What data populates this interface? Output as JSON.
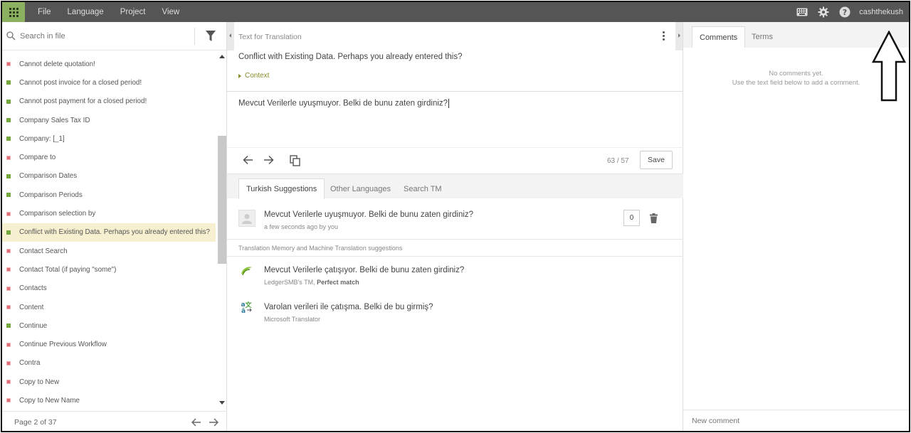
{
  "topbar": {
    "menu": [
      "File",
      "Language",
      "Project",
      "View"
    ],
    "username": "cashthekush",
    "accent": "#8bb05f"
  },
  "left": {
    "search_placeholder": "Search in file",
    "items": [
      {
        "label": "Cannot delete quotation!",
        "status": "red"
      },
      {
        "label": "Cannot post invoice for a closed period!",
        "status": "green"
      },
      {
        "label": "Cannot post payment for a closed period!",
        "status": "green"
      },
      {
        "label": "Company Sales Tax ID",
        "status": "green"
      },
      {
        "label": "Company: [_1]",
        "status": "green"
      },
      {
        "label": "Compare to",
        "status": "red"
      },
      {
        "label": "Comparison Dates",
        "status": "green"
      },
      {
        "label": "Comparison Periods",
        "status": "green"
      },
      {
        "label": "Comparison selection by",
        "status": "red"
      },
      {
        "label": "Conflict with Existing Data. Perhaps you already entered this?",
        "status": "green",
        "selected": true
      },
      {
        "label": "Contact Search",
        "status": "red"
      },
      {
        "label": "Contact Total (if paying \"some\")",
        "status": "red"
      },
      {
        "label": "Contacts",
        "status": "red"
      },
      {
        "label": "Content",
        "status": "red"
      },
      {
        "label": "Continue",
        "status": "green"
      },
      {
        "label": "Continue Previous Workflow",
        "status": "red"
      },
      {
        "label": "Contra",
        "status": "red"
      },
      {
        "label": "Copy to New",
        "status": "red"
      },
      {
        "label": "Copy to New Name",
        "status": "red"
      }
    ],
    "pager": "Page 2 of 37"
  },
  "middle": {
    "header": "Text for Translation",
    "source": "Conflict with Existing Data.  Perhaps you already entered this?",
    "context_label": "Context",
    "target": "Mevcut Verilerle uyuşmuyor. Belki de bunu zaten girdiniz?",
    "char_count": "63 / 57",
    "save_label": "Save",
    "tabs": [
      "Turkish Suggestions",
      "Other Languages",
      "Search TM"
    ],
    "own_suggestion": {
      "text": "Mevcut Verilerle uyuşmuyor. Belki de bunu zaten girdiniz?",
      "meta": "a few seconds ago by you",
      "count": "0"
    },
    "tm_header": "Translation Memory and Machine Translation suggestions",
    "tm_suggestions": [
      {
        "text": "Mevcut Verilerle çatışıyor. Belki de bunu zaten girdiniz?",
        "source": "LedgerSMB's TM,",
        "match": "Perfect match",
        "icon": "tm-icon"
      },
      {
        "text": "Varolan verileri ile çatışma.  Belki de bu girmiş?",
        "source": "Microsoft Translator",
        "match": "",
        "icon": "translator-icon"
      }
    ]
  },
  "right": {
    "tabs": [
      "Comments",
      "Terms"
    ],
    "empty_line1": "No comments yet.",
    "empty_line2": "Use the text field below to add a comment.",
    "new_comment_placeholder": "New comment"
  }
}
